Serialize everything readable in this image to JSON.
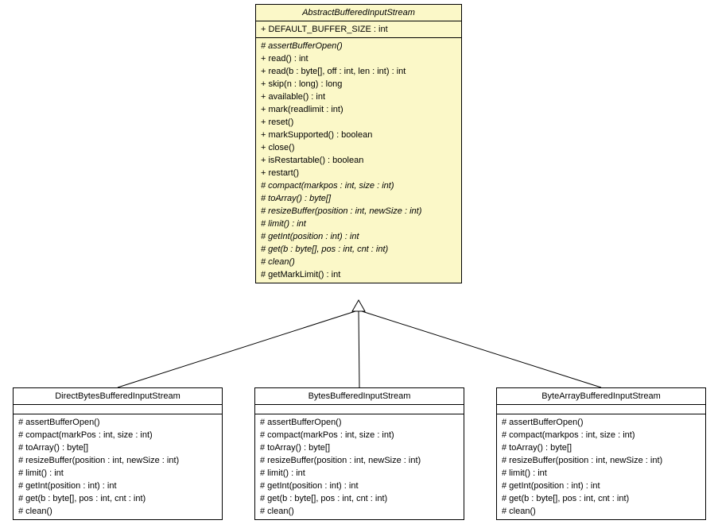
{
  "parent": {
    "name": "AbstractBufferedInputStream",
    "nameItalic": true,
    "attrs": [
      {
        "text": "+ DEFAULT_BUFFER_SIZE : int",
        "italic": false
      }
    ],
    "ops": [
      {
        "text": "# assertBufferOpen()",
        "italic": true
      },
      {
        "text": "+ read() : int",
        "italic": false
      },
      {
        "text": "+ read(b : byte[], off : int, len : int) : int",
        "italic": false
      },
      {
        "text": "+ skip(n : long) : long",
        "italic": false
      },
      {
        "text": "+ available() : int",
        "italic": false
      },
      {
        "text": "+ mark(readlimit : int)",
        "italic": false
      },
      {
        "text": "+ reset()",
        "italic": false
      },
      {
        "text": "+ markSupported() : boolean",
        "italic": false
      },
      {
        "text": "+ close()",
        "italic": false
      },
      {
        "text": "+ isRestartable() : boolean",
        "italic": false
      },
      {
        "text": "+ restart()",
        "italic": false
      },
      {
        "text": "# compact(markpos : int, size : int)",
        "italic": true
      },
      {
        "text": "# toArray() : byte[]",
        "italic": true
      },
      {
        "text": "# resizeBuffer(position : int, newSize : int)",
        "italic": true
      },
      {
        "text": "# limit() : int",
        "italic": true
      },
      {
        "text": "# getInt(position : int) : int",
        "italic": true
      },
      {
        "text": "# get(b : byte[], pos : int, cnt : int)",
        "italic": true
      },
      {
        "text": "# clean()",
        "italic": true
      },
      {
        "text": "# getMarkLimit() : int",
        "italic": false
      }
    ]
  },
  "children": [
    {
      "name": "DirectBytesBufferedInputStream",
      "ops": [
        {
          "text": "# assertBufferOpen()",
          "italic": false
        },
        {
          "text": "# compact(markPos : int, size : int)",
          "italic": false
        },
        {
          "text": "# toArray() : byte[]",
          "italic": false
        },
        {
          "text": "# resizeBuffer(position : int, newSize : int)",
          "italic": false
        },
        {
          "text": "# limit() : int",
          "italic": false
        },
        {
          "text": "# getInt(position : int) : int",
          "italic": false
        },
        {
          "text": "# get(b : byte[], pos : int, cnt : int)",
          "italic": false
        },
        {
          "text": "# clean()",
          "italic": false
        }
      ]
    },
    {
      "name": "BytesBufferedInputStream",
      "ops": [
        {
          "text": "# assertBufferOpen()",
          "italic": false
        },
        {
          "text": "# compact(markPos : int, size : int)",
          "italic": false
        },
        {
          "text": "# toArray() : byte[]",
          "italic": false
        },
        {
          "text": "# resizeBuffer(position : int, newSize : int)",
          "italic": false
        },
        {
          "text": "# limit() : int",
          "italic": false
        },
        {
          "text": "# getInt(position : int) : int",
          "italic": false
        },
        {
          "text": "# get(b : byte[], pos : int, cnt : int)",
          "italic": false
        },
        {
          "text": "# clean()",
          "italic": false
        }
      ]
    },
    {
      "name": "ByteArrayBufferedInputStream",
      "ops": [
        {
          "text": "# assertBufferOpen()",
          "italic": false
        },
        {
          "text": "# compact(markpos : int, size : int)",
          "italic": false
        },
        {
          "text": "# toArray() : byte[]",
          "italic": false
        },
        {
          "text": "# resizeBuffer(position : int, newSize : int)",
          "italic": false
        },
        {
          "text": "# limit() : int",
          "italic": false
        },
        {
          "text": "# getInt(position : int) : int",
          "italic": false
        },
        {
          "text": "# get(b : byte[], pos : int, cnt : int)",
          "italic": false
        },
        {
          "text": "# clean()",
          "italic": false
        }
      ]
    }
  ]
}
